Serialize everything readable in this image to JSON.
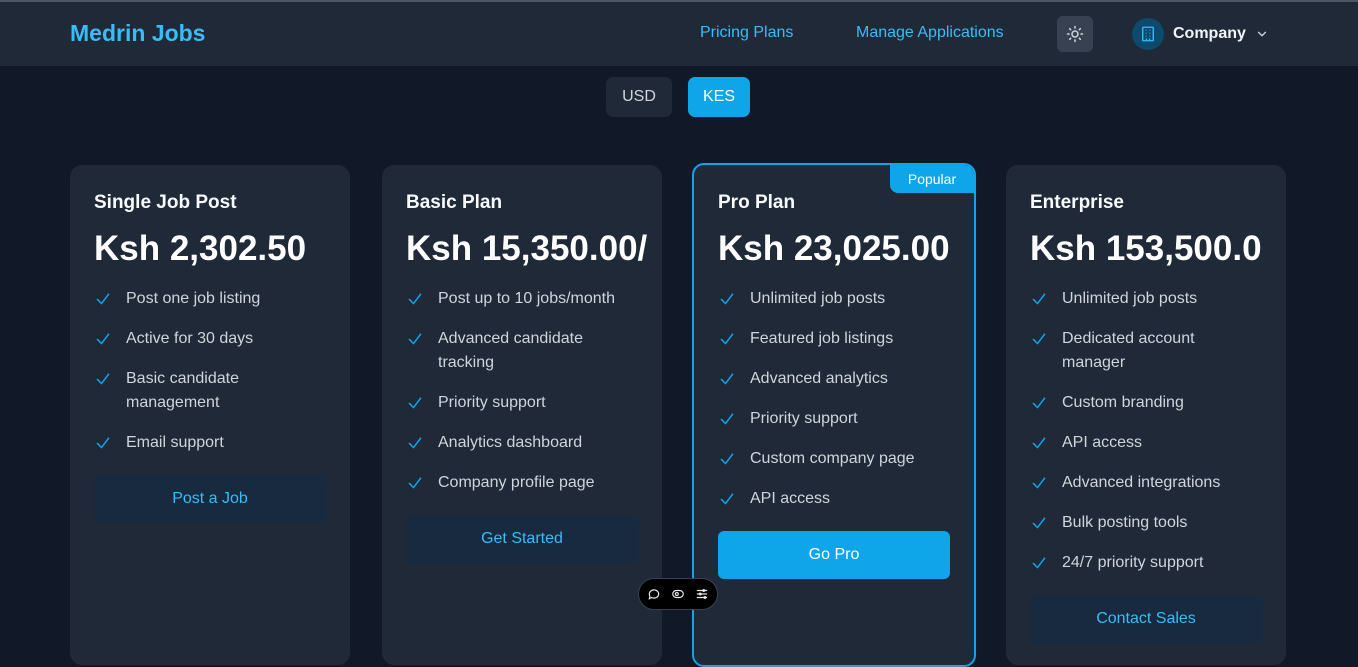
{
  "header": {
    "brand": "Medrin Jobs",
    "nav": {
      "pricing_plans": "Pricing Plans",
      "manage_applications": "Manage Applications"
    },
    "theme_icon": "sun-icon",
    "account": {
      "label": "Company",
      "icon": "building-icon",
      "chevron": "chevron-down-icon"
    }
  },
  "currency_toggle": {
    "options": [
      "USD",
      "KES"
    ],
    "selected": "KES"
  },
  "plans": [
    {
      "name": "Single Job Post",
      "price": "Ksh 2,302.50",
      "features": [
        "Post one job listing",
        "Active for 30 days",
        "Basic candidate management",
        "Email support"
      ],
      "cta": "Post a Job"
    },
    {
      "name": "Basic Plan",
      "price": "Ksh 15,350.00/",
      "features": [
        "Post up to 10 jobs/month",
        "Advanced candidate tracking",
        "Priority support",
        "Analytics dashboard",
        "Company profile page"
      ],
      "cta": "Get Started"
    },
    {
      "name": "Pro Plan",
      "badge": "Popular",
      "price": "Ksh 23,025.00",
      "features": [
        "Unlimited job posts",
        "Featured job listings",
        "Advanced analytics",
        "Priority support",
        "Custom company page",
        "API access"
      ],
      "cta": "Go Pro"
    },
    {
      "name": "Enterprise",
      "price": "Ksh 153,500.0",
      "features": [
        "Unlimited job posts",
        "Dedicated account manager",
        "Custom branding",
        "API access",
        "Advanced integrations",
        "Bulk posting tools",
        "24/7 priority support"
      ],
      "cta": "Contact Sales"
    }
  ],
  "colors": {
    "background": "#111827",
    "card": "#1f2937",
    "accent": "#0ea5e9",
    "link": "#38bdf8"
  },
  "floating_toolbar": {
    "icons": [
      "comment-icon",
      "eye-icon",
      "sliders-icon"
    ]
  }
}
